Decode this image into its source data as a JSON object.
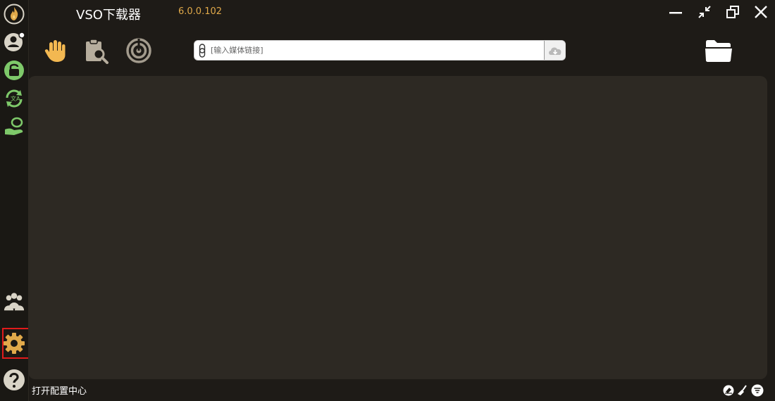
{
  "app": {
    "title": "VSO下载器",
    "version": "6.0.0.102"
  },
  "url_bar": {
    "placeholder": "[输入媒体链接]"
  },
  "status": {
    "text": "打开配置中心"
  },
  "colors": {
    "accent": "#e0a94a",
    "green": "#7ec96a",
    "background": "#1e1b17",
    "panel": "#2d2923",
    "highlight": "#e01b1b"
  },
  "icons": {
    "sidebar": [
      "flame-logo-icon",
      "user-icon",
      "unlock-icon",
      "translate-refresh-icon",
      "hand-coin-icon",
      "team-icon",
      "gear-icon",
      "help-icon"
    ],
    "toolbar": [
      "hand-stop-icon",
      "clipboard-search-icon",
      "radar-icon",
      "folder-icon"
    ],
    "window": [
      "minimize-icon",
      "shrink-icon",
      "restore-icon",
      "close-icon"
    ],
    "footer": [
      "eraser-icon",
      "broom-icon",
      "filter-icon"
    ]
  }
}
